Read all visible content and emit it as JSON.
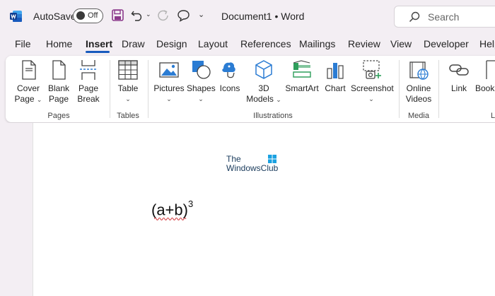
{
  "titlebar": {
    "autosave_label": "AutoSave",
    "autosave_state": "Off",
    "document_title": "Document1  •  Word",
    "search_placeholder": "Search"
  },
  "tabs": [
    "File",
    "Home",
    "Insert",
    "Draw",
    "Design",
    "Layout",
    "References",
    "Mailings",
    "Review",
    "View",
    "Developer",
    "Help"
  ],
  "active_tab": "Insert",
  "ribbon": {
    "cover_page": [
      "Cover",
      "Page"
    ],
    "blank_page": [
      "Blank",
      "Page"
    ],
    "page_break": [
      "Page",
      "Break"
    ],
    "table": "Table",
    "pictures": "Pictures",
    "shapes": "Shapes",
    "icons": "Icons",
    "models_3d": [
      "3D",
      "Models"
    ],
    "smartart": "SmartArt",
    "chart": "Chart",
    "screenshot": "Screenshot",
    "online_videos": [
      "Online",
      "Videos"
    ],
    "link": "Link",
    "bookmark": "Book",
    "groups": {
      "pages": "Pages",
      "tables": "Tables",
      "illustrations": "Illustrations",
      "media": "Media",
      "links": "Li"
    }
  },
  "document": {
    "watermark_line1": "The",
    "watermark_line2": "WindowsClub",
    "formula_base": "(a+b)",
    "formula_exponent": "3"
  },
  "colors": {
    "accent": "#185abd",
    "ribbon_icon_blue": "#2b7cd3",
    "smartart_green": "#2e9e5b"
  }
}
